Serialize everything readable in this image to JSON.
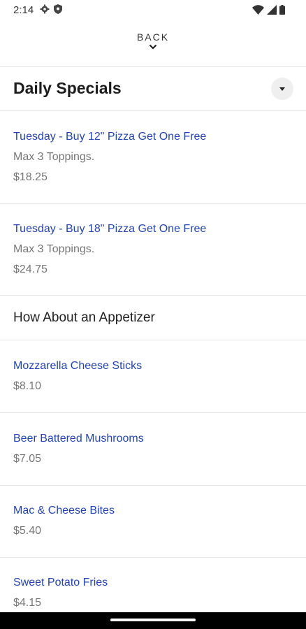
{
  "status_bar": {
    "time": "2:14"
  },
  "back": {
    "label": "BACK"
  },
  "section": {
    "title": "Daily Specials"
  },
  "specials": [
    {
      "name": "Tuesday - Buy 12\" Pizza Get One Free",
      "description": "Max 3 Toppings.",
      "price": "$18.25"
    },
    {
      "name": "Tuesday - Buy 18\" Pizza Get One Free",
      "description": "Max 3 Toppings.",
      "price": "$24.75"
    }
  ],
  "appetizer_header": "How About an Appetizer",
  "appetizers": [
    {
      "name": "Mozzarella Cheese Sticks",
      "price": "$8.10"
    },
    {
      "name": "Beer Battered Mushrooms",
      "price": "$7.05"
    },
    {
      "name": "Mac & Cheese Bites",
      "price": "$5.40"
    },
    {
      "name": "Sweet Potato Fries",
      "price": "$4.15"
    }
  ],
  "colors": {
    "link": "#2344b8",
    "muted": "#777777",
    "divider": "#e6e6e6"
  }
}
